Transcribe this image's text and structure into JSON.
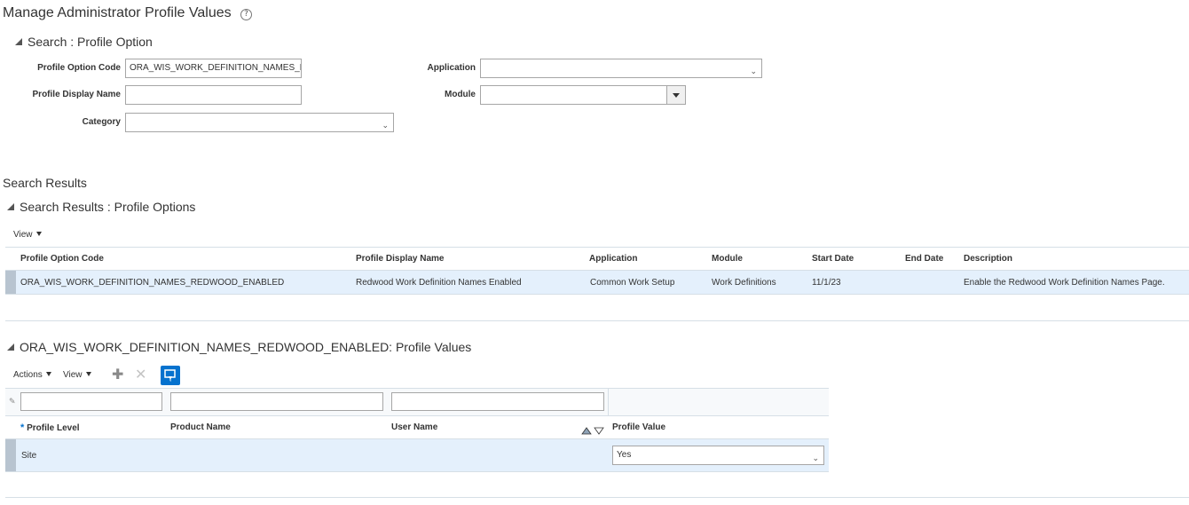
{
  "page": {
    "title": "Manage Administrator Profile Values",
    "help_icon": "question-circle-icon"
  },
  "search": {
    "header": "Search : Profile Option",
    "fields": {
      "profile_option_code": {
        "label": "Profile Option Code",
        "value": "ORA_WIS_WORK_DEFINITION_NAMES_REDWOOD_ENABLED"
      },
      "profile_display_name": {
        "label": "Profile Display Name",
        "value": ""
      },
      "category": {
        "label": "Category",
        "value": ""
      },
      "application": {
        "label": "Application",
        "value": ""
      },
      "module": {
        "label": "Module",
        "value": ""
      }
    }
  },
  "results": {
    "title": "Search Results",
    "header": "Search Results : Profile Options",
    "view_label": "View",
    "columns": {
      "code": "Profile Option Code",
      "display_name": "Profile Display Name",
      "application": "Application",
      "module": "Module",
      "start_date": "Start Date",
      "end_date": "End Date",
      "description": "Description"
    },
    "rows": [
      {
        "code": "ORA_WIS_WORK_DEFINITION_NAMES_REDWOOD_ENABLED",
        "display_name": "Redwood Work Definition Names Enabled",
        "application": "Common Work Setup",
        "module": "Work Definitions",
        "start_date": "11/1/23",
        "end_date": "",
        "description": "Enable the Redwood Work Definition Names Page."
      }
    ]
  },
  "values": {
    "header": "ORA_WIS_WORK_DEFINITION_NAMES_REDWOOD_ENABLED: Profile Values",
    "actions_label": "Actions",
    "view_label": "View",
    "add_icon": "plus-icon",
    "delete_icon": "x-icon",
    "filter_icon": "query-by-example-icon",
    "sort_icons": "sort-ascending-descending-icon",
    "columns": {
      "required_mark": "*",
      "profile_level": "Profile Level",
      "product_name": "Product Name",
      "user_name": "User Name",
      "profile_value": "Profile Value"
    },
    "rows": [
      {
        "profile_level": "Site",
        "product_name": "",
        "user_name": "",
        "profile_value": "Yes"
      }
    ]
  },
  "colors": {
    "selected_row": "#e4f0fc",
    "accent_button": "#0572ce",
    "border": "#a6a6a6"
  }
}
